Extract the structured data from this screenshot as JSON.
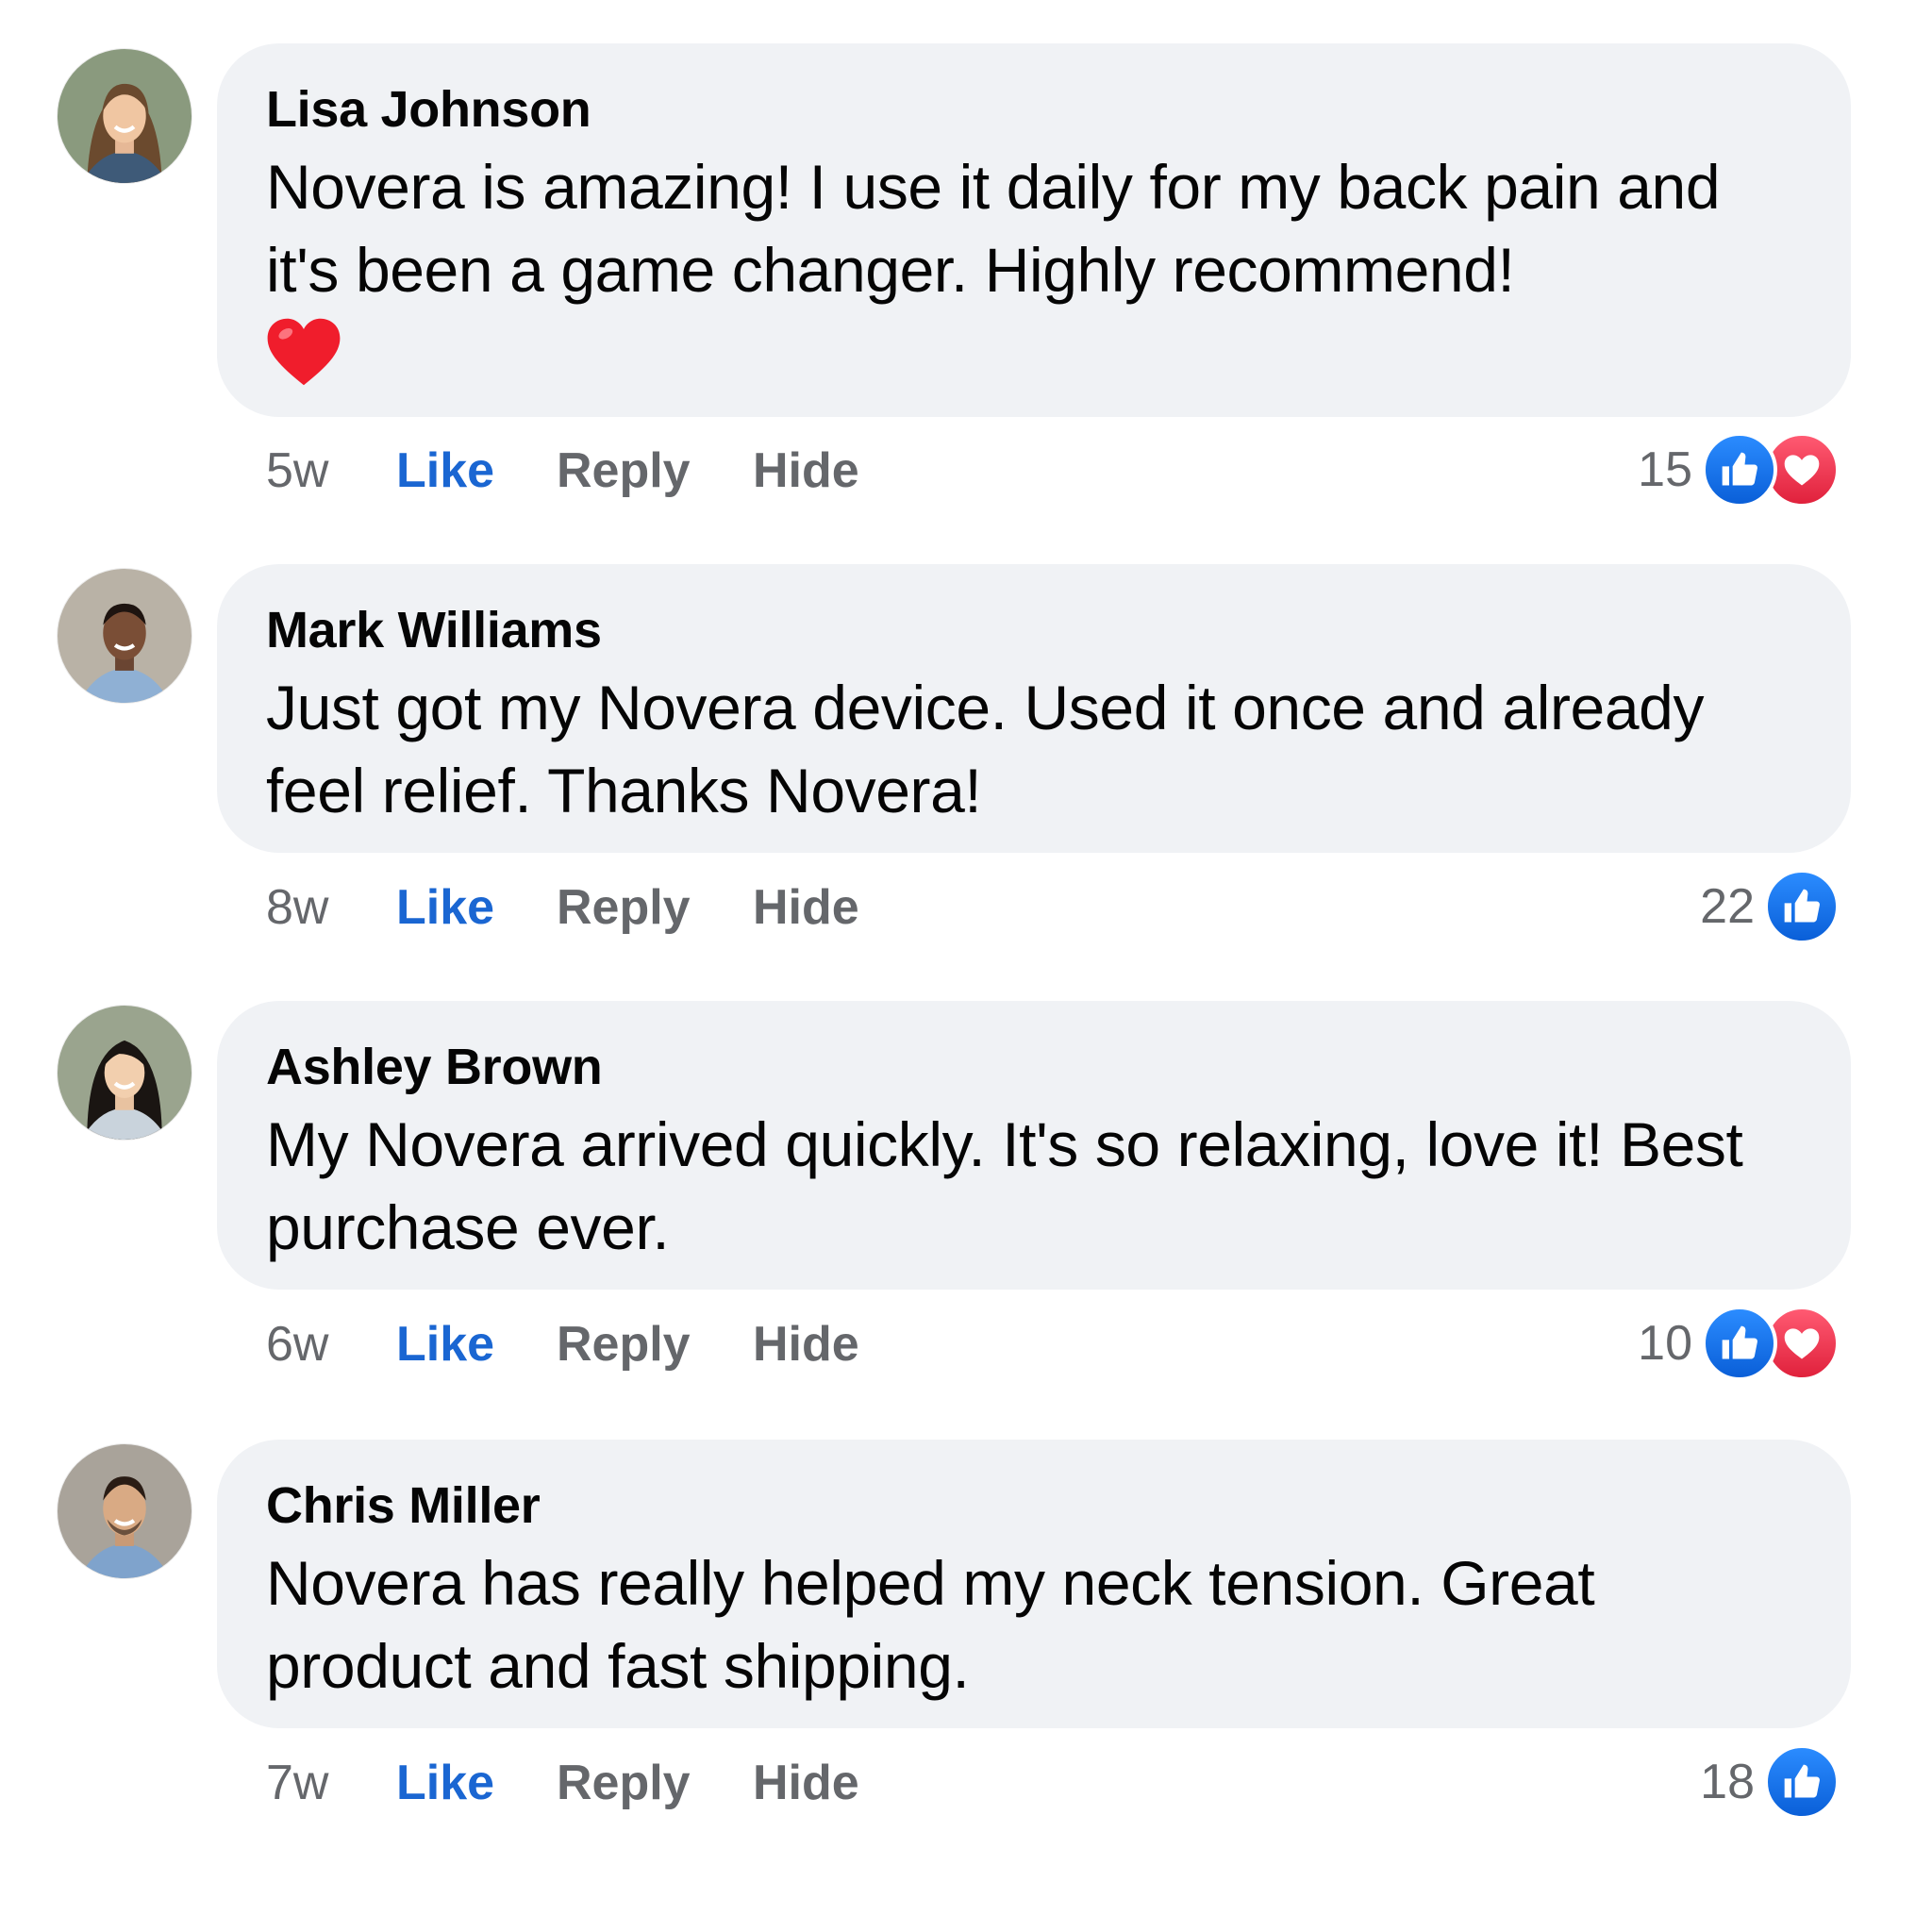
{
  "comments": [
    {
      "author": "Lisa Johnson",
      "text": "Novera is amazing! I use it daily for my back pain and it's been a game changer. Highly recommend!",
      "has_heart_emoji": true,
      "time": "5w",
      "like_label": "Like",
      "reply_label": "Reply",
      "hide_label": "Hide",
      "reaction_count": "15",
      "reactions": [
        "like-icon",
        "love-icon"
      ]
    },
    {
      "author": "Mark Williams",
      "text": "Just got my Novera device. Used it once and already feel relief. Thanks Novera!",
      "has_heart_emoji": false,
      "time": "8w",
      "like_label": "Like",
      "reply_label": "Reply",
      "hide_label": "Hide",
      "reaction_count": "22",
      "reactions": [
        "like-icon"
      ]
    },
    {
      "author": "Ashley Brown",
      "text": "My Novera arrived quickly. It's so relaxing, love it! Best purchase ever.",
      "has_heart_emoji": false,
      "time": "6w",
      "like_label": "Like",
      "reply_label": "Reply",
      "hide_label": "Hide",
      "reaction_count": "10",
      "reactions": [
        "like-icon",
        "love-icon"
      ]
    },
    {
      "author": "Chris Miller",
      "text": "Novera has really helped my neck tension. Great product and fast shipping.",
      "has_heart_emoji": false,
      "time": "7w",
      "like_label": "Like",
      "reply_label": "Reply",
      "hide_label": "Hide",
      "reaction_count": "18",
      "reactions": [
        "like-icon"
      ]
    }
  ],
  "colors": {
    "bubble": "#f0f2f5",
    "like_blue": "#1a66d2",
    "muted": "#65676b",
    "text": "#050505"
  }
}
